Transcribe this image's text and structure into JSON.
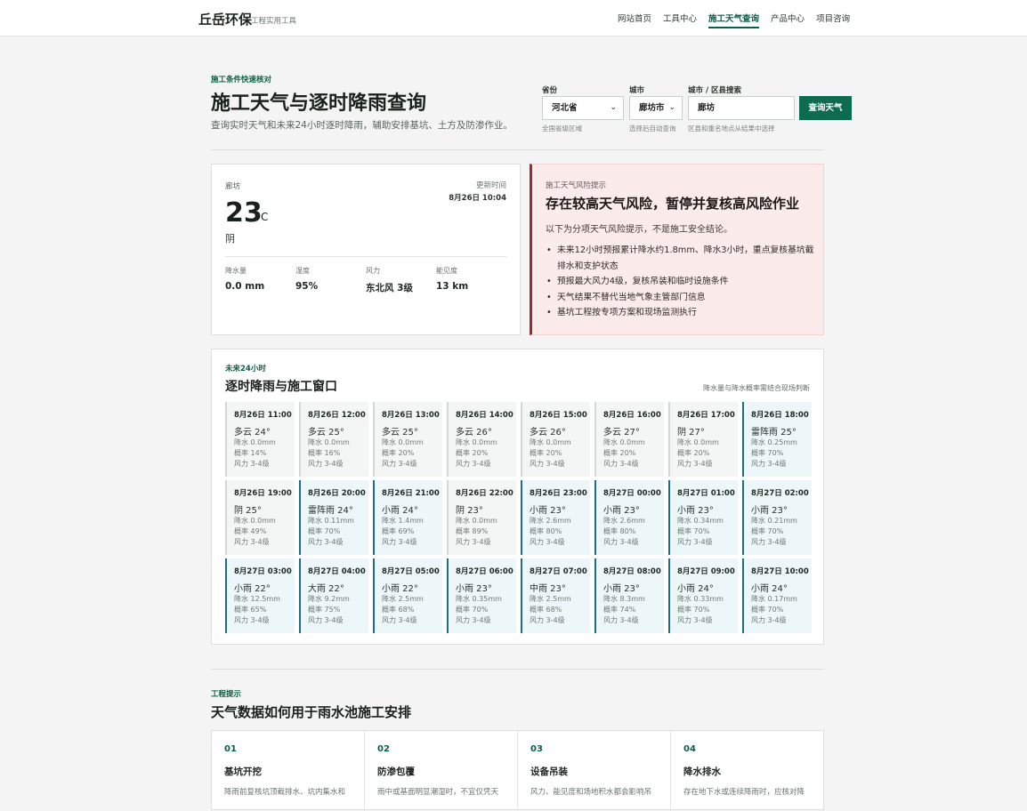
{
  "nav": {
    "brand": "丘岳环保",
    "brand_sub": "工程实用工具",
    "links": [
      {
        "label": "网站首页",
        "active": false
      },
      {
        "label": "工具中心",
        "active": false
      },
      {
        "label": "施工天气查询",
        "active": true
      },
      {
        "label": "产品中心",
        "active": false
      },
      {
        "label": "项目咨询",
        "active": false
      }
    ]
  },
  "hero": {
    "eyebrow": "施工条件快速核对",
    "title": "施工天气与逐时降雨查询",
    "desc": "查询实时天气和未来24小时逐时降雨，辅助安排基坑、土方及防渗作业。"
  },
  "form": {
    "province_label": "省份",
    "province_value": "河北省",
    "province_hint": "全国省级区域",
    "city_label": "城市",
    "city_value": "廊坊市",
    "city_hint": "选择后自动查询",
    "search_label": "城市 / 区县搜索",
    "search_value": "廊坊",
    "search_hint": "区县和重名地点从结果中选择",
    "query_button": "查询天气"
  },
  "current": {
    "city": "廊坊",
    "update_label": "更新时间",
    "update_time": "8月26日 10:04",
    "temp": "23",
    "unit": "°C",
    "condition": "阴",
    "metrics": [
      {
        "label": "降水量",
        "value": "0.0 mm"
      },
      {
        "label": "湿度",
        "value": "95%"
      },
      {
        "label": "风力",
        "value": "东北风 3级"
      },
      {
        "label": "能见度",
        "value": "13 km"
      }
    ]
  },
  "risk": {
    "label": "施工天气风险提示",
    "title": "存在较高天气风险，暂停并复核高风险作业",
    "desc": "以下为分项天气风险提示，不是施工安全结论。",
    "items": [
      "未来12小时预报累计降水约1.8mm、降水3小时，重点复核基坑截排水和支护状态",
      "预报最大风力4级，复核吊装和临时设施条件",
      "天气结果不替代当地气象主管部门信息",
      "基坑工程按专项方案和现场监测执行"
    ]
  },
  "hourly": {
    "eyebrow": "未来24小时",
    "title": "逐时降雨与施工窗口",
    "note": "降水量与降水概率需结合现场判断",
    "hours": [
      {
        "time": "8月26日 11:00",
        "cond": "多云 24°",
        "precip": "降水 0.0mm",
        "prob": "概率 14%",
        "wind": "风力 3-4级",
        "rain": false
      },
      {
        "time": "8月26日 12:00",
        "cond": "多云 25°",
        "precip": "降水 0.0mm",
        "prob": "概率 16%",
        "wind": "风力 3-4级",
        "rain": false
      },
      {
        "time": "8月26日 13:00",
        "cond": "多云 25°",
        "precip": "降水 0.0mm",
        "prob": "概率 20%",
        "wind": "风力 3-4级",
        "rain": false
      },
      {
        "time": "8月26日 14:00",
        "cond": "多云 26°",
        "precip": "降水 0.0mm",
        "prob": "概率 20%",
        "wind": "风力 3-4级",
        "rain": false
      },
      {
        "time": "8月26日 15:00",
        "cond": "多云 26°",
        "precip": "降水 0.0mm",
        "prob": "概率 20%",
        "wind": "风力 3-4级",
        "rain": false
      },
      {
        "time": "8月26日 16:00",
        "cond": "多云 27°",
        "precip": "降水 0.0mm",
        "prob": "概率 20%",
        "wind": "风力 3-4级",
        "rain": false
      },
      {
        "time": "8月26日 17:00",
        "cond": "阴 27°",
        "precip": "降水 0.0mm",
        "prob": "概率 20%",
        "wind": "风力 3-4级",
        "rain": false
      },
      {
        "time": "8月26日 18:00",
        "cond": "雷阵雨 25°",
        "precip": "降水 0.25mm",
        "prob": "概率 70%",
        "wind": "风力 3-4级",
        "rain": true
      },
      {
        "time": "8月26日 19:00",
        "cond": "阴 25°",
        "precip": "降水 0.0mm",
        "prob": "概率 49%",
        "wind": "风力 3-4级",
        "rain": false
      },
      {
        "time": "8月26日 20:00",
        "cond": "雷阵雨 24°",
        "precip": "降水 0.11mm",
        "prob": "概率 70%",
        "wind": "风力 3-4级",
        "rain": true
      },
      {
        "time": "8月26日 21:00",
        "cond": "小雨 24°",
        "precip": "降水 1.4mm",
        "prob": "概率 69%",
        "wind": "风力 3-4级",
        "rain": true
      },
      {
        "time": "8月26日 22:00",
        "cond": "阴 23°",
        "precip": "降水 0.0mm",
        "prob": "概率 89%",
        "wind": "风力 3-4级",
        "rain": false
      },
      {
        "time": "8月26日 23:00",
        "cond": "小雨 23°",
        "precip": "降水 2.6mm",
        "prob": "概率 80%",
        "wind": "风力 3-4级",
        "rain": true
      },
      {
        "time": "8月27日 00:00",
        "cond": "小雨 23°",
        "precip": "降水 2.6mm",
        "prob": "概率 80%",
        "wind": "风力 3-4级",
        "rain": true
      },
      {
        "time": "8月27日 01:00",
        "cond": "小雨 23°",
        "precip": "降水 0.34mm",
        "prob": "概率 70%",
        "wind": "风力 3-4级",
        "rain": true
      },
      {
        "time": "8月27日 02:00",
        "cond": "小雨 23°",
        "precip": "降水 0.21mm",
        "prob": "概率 70%",
        "wind": "风力 3-4级",
        "rain": true
      },
      {
        "time": "8月27日 03:00",
        "cond": "小雨 22°",
        "precip": "降水 12.5mm",
        "prob": "概率 65%",
        "wind": "风力 3-4级",
        "rain": true
      },
      {
        "time": "8月27日 04:00",
        "cond": "大雨 22°",
        "precip": "降水 9.2mm",
        "prob": "概率 75%",
        "wind": "风力 3-4级",
        "rain": true
      },
      {
        "time": "8月27日 05:00",
        "cond": "小雨 22°",
        "precip": "降水 2.5mm",
        "prob": "概率 68%",
        "wind": "风力 3-4级",
        "rain": true
      },
      {
        "time": "8月27日 06:00",
        "cond": "小雨 23°",
        "precip": "降水 0.35mm",
        "prob": "概率 70%",
        "wind": "风力 3-4级",
        "rain": true
      },
      {
        "time": "8月27日 07:00",
        "cond": "中雨 23°",
        "precip": "降水 2.5mm",
        "prob": "概率 68%",
        "wind": "风力 3-4级",
        "rain": true
      },
      {
        "time": "8月27日 08:00",
        "cond": "小雨 23°",
        "precip": "降水 8.3mm",
        "prob": "概率 74%",
        "wind": "风力 3-4级",
        "rain": true
      },
      {
        "time": "8月27日 09:00",
        "cond": "小雨 24°",
        "precip": "降水 0.33mm",
        "prob": "概率 70%",
        "wind": "风力 3-4级",
        "rain": true
      },
      {
        "time": "8月27日 10:00",
        "cond": "小雨 24°",
        "precip": "降水 0.17mm",
        "prob": "概率 70%",
        "wind": "风力 3-4级",
        "rain": true
      }
    ]
  },
  "tips": {
    "eyebrow": "工程提示",
    "title": "天气数据如何用于雨水池施工安排",
    "cards": [
      {
        "num": "01",
        "title": "基坑开挖",
        "desc": "降雨前复核坑顶截排水、坑内集水和"
      },
      {
        "num": "02",
        "title": "防渗包覆",
        "desc": "雨中或基面明显潮湿时，不宜仅凭天"
      },
      {
        "num": "03",
        "title": "设备吊装",
        "desc": "风力、能见度和场地积水都会影响吊"
      },
      {
        "num": "04",
        "title": "降水排水",
        "desc": "存在地下水或连续降雨时，应核对降"
      }
    ]
  }
}
